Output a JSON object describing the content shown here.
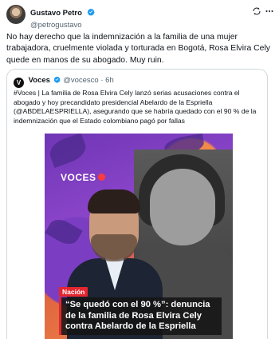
{
  "author": {
    "name": "Gustavo Petro",
    "handle": "@petrogustavo"
  },
  "tweet": {
    "text": "No hay derecho que la indemnización a la familia de una mujer trabajadora,  cruelmente violada y torturada en Bogotá, Rosa Elvira Cely quede en manos de su abogado. Muy ruin."
  },
  "quoted": {
    "logo_letter": "V",
    "name": "Voces",
    "meta": "@vocesco · 6h",
    "text": "#Voces | La familia de Rosa Elvira Cely lanzó serias acusaciones contra el abogado y hoy precandidato presidencial Abelardo de la Espriella (@ABDELAESPRIELLA), asegurando que se habría quedado con el 90 % de la indemnización que el Estado colombiano pagó por fallas",
    "image": {
      "brand": "VOCES",
      "tag": "Nación",
      "headline": "“Se quedó con el 90 %”: denuncia de la familia de Rosa Elvira Cely contra Abelardo de la Espriella"
    }
  },
  "icons": {
    "verified": "verified-badge-icon",
    "grok": "grok-icon",
    "more": "more-icon"
  },
  "colors": {
    "verified_blue": "#1d9bf0",
    "text": "#0f1419",
    "secondary": "#536471",
    "border": "#cfd9de",
    "accent_red": "#e3262f"
  }
}
